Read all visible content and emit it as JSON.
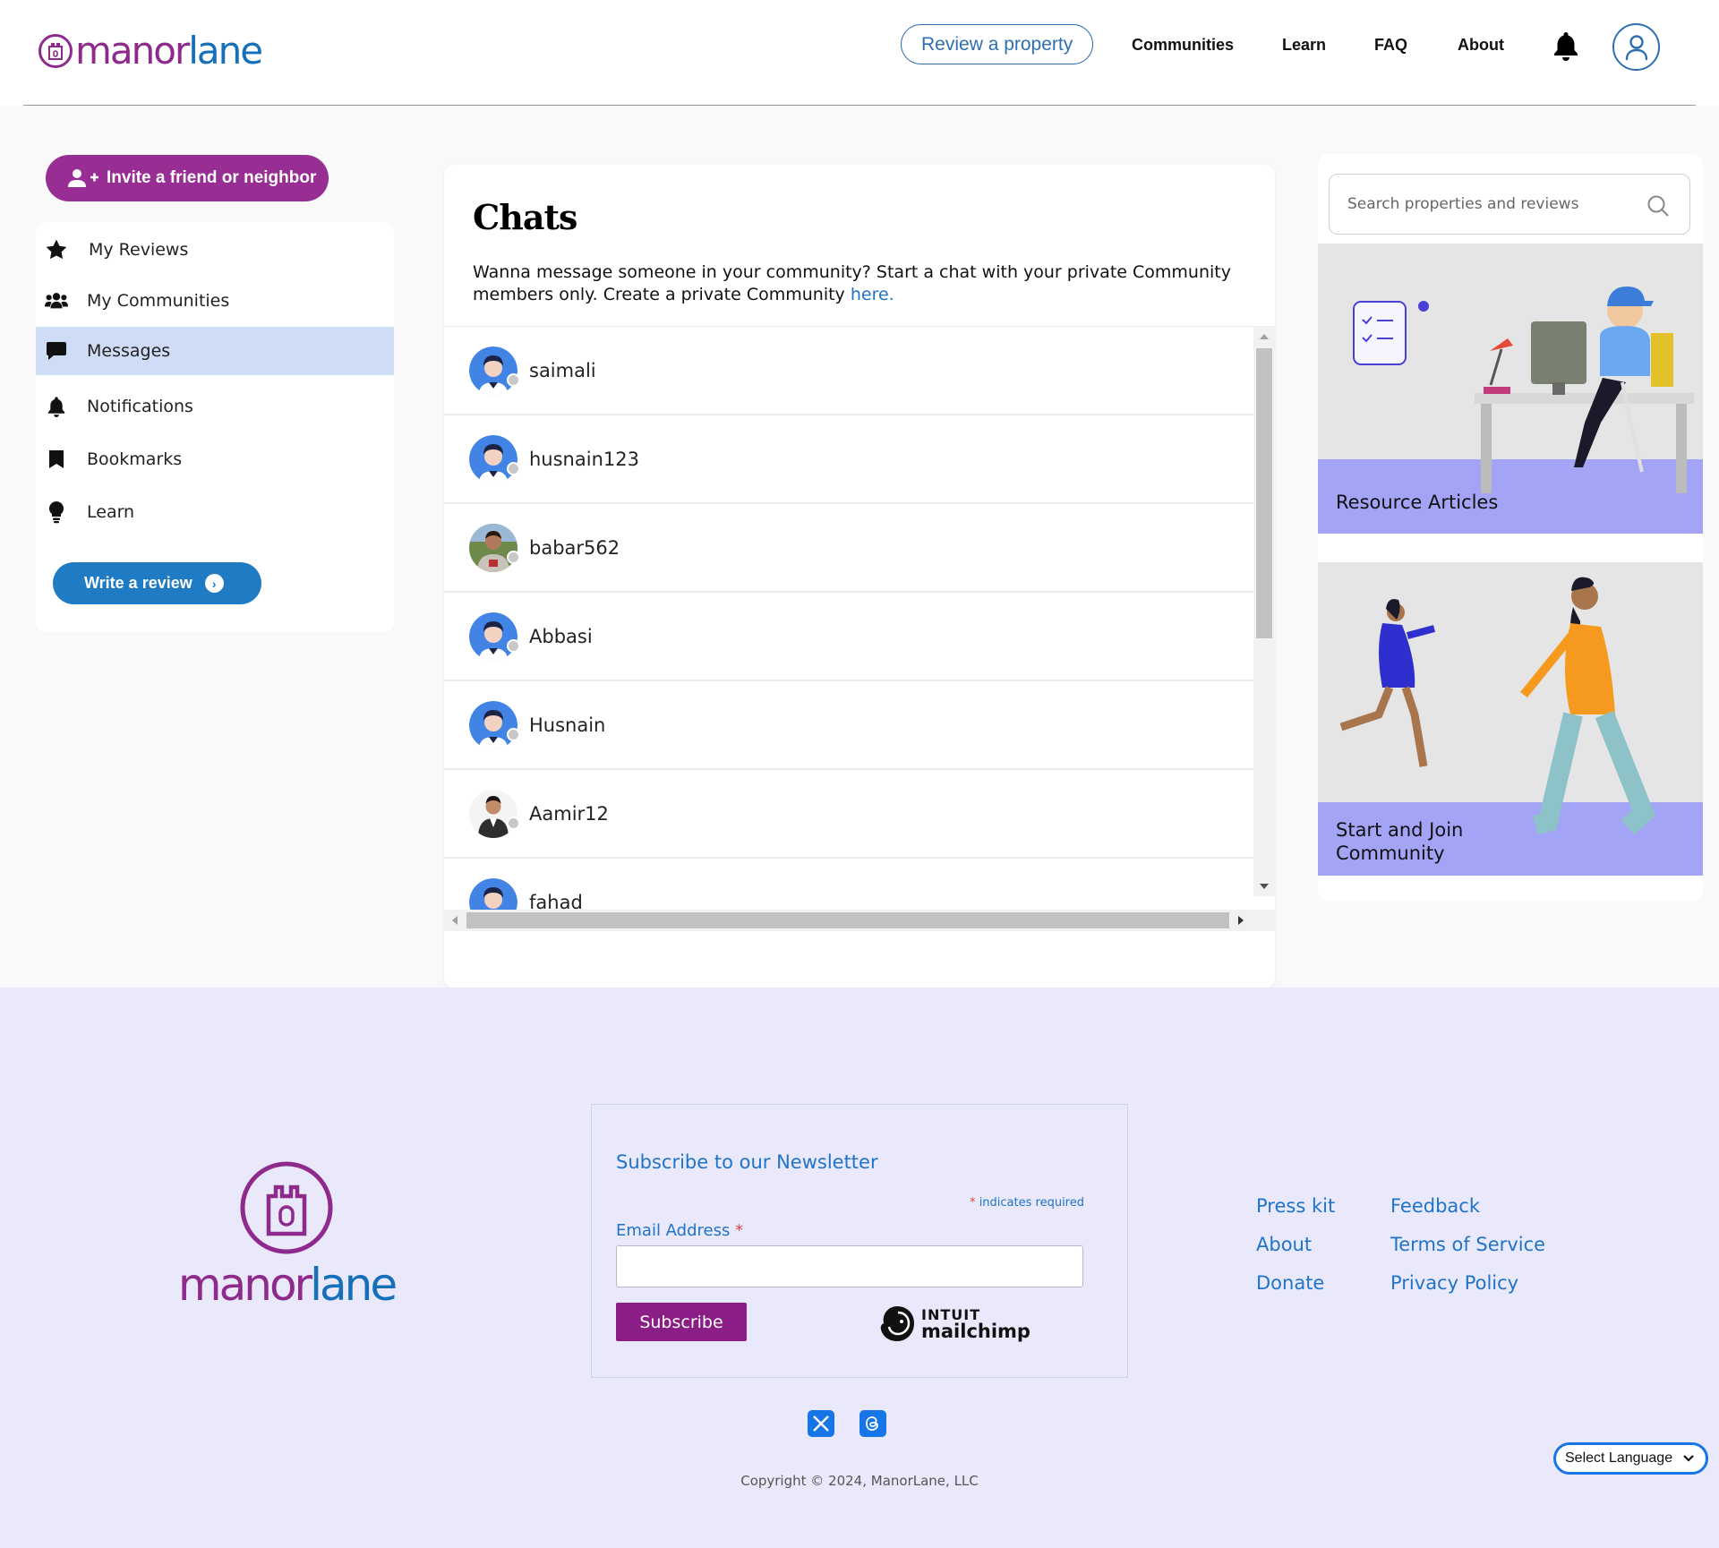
{
  "header": {
    "logo_manor": "manor",
    "logo_lane": "lane",
    "review_button": "Review a property",
    "nav": [
      "Communities",
      "Learn",
      "FAQ",
      "About"
    ]
  },
  "sidebar": {
    "invite_button": "Invite a friend or neighbor",
    "items": [
      {
        "label": "My Reviews",
        "icon": "star-icon"
      },
      {
        "label": "My Communities",
        "icon": "users-icon"
      },
      {
        "label": "Messages",
        "icon": "chat-bubble-icon",
        "active": true
      },
      {
        "label": "Notifications",
        "icon": "bell-icon"
      },
      {
        "label": "Bookmarks",
        "icon": "bookmark-icon"
      },
      {
        "label": "Learn",
        "icon": "lightbulb-icon"
      }
    ],
    "write_review_button": "Write a review"
  },
  "chats": {
    "title": "Chats",
    "description": "Wanna message someone in your community? Start a chat with your private Community members only. Create a private Community",
    "link_text": "here.",
    "users": [
      {
        "name": "saimali",
        "avatar": "cartoon"
      },
      {
        "name": "husnain123",
        "avatar": "cartoon"
      },
      {
        "name": "babar562",
        "avatar": "photo"
      },
      {
        "name": "Abbasi",
        "avatar": "cartoon"
      },
      {
        "name": "Husnain",
        "avatar": "cartoon"
      },
      {
        "name": "Aamir12",
        "avatar": "photo"
      },
      {
        "name": "fahad",
        "avatar": "cartoon"
      }
    ]
  },
  "right": {
    "search_placeholder": "Search properties and reviews",
    "promo1": "Resource Articles",
    "promo2_line1": "Start and Join",
    "promo2_line2": "Community"
  },
  "footer": {
    "logo_manor": "manor",
    "logo_lane": "lane",
    "newsletter_title": "Subscribe to our Newsletter",
    "required_note": "indicates required",
    "email_label": "Email Address",
    "subscribe_button": "Subscribe",
    "mailchimp_top": "INTUIT",
    "mailchimp_bottom": "mailchimp",
    "links_col1": [
      "Press kit",
      "About",
      "Donate"
    ],
    "links_col2": [
      "Feedback",
      "Terms of Service",
      "Privacy Policy"
    ],
    "copyright": "Copyright © 2024, ManorLane, LLC",
    "language": "Select Language"
  },
  "colors": {
    "brand_purple": "#982e94",
    "brand_blue": "#1670b9",
    "active_item": "#cfdcf6",
    "promo_band": "#a4a4f7",
    "footer_bg": "#e9e9fb"
  }
}
